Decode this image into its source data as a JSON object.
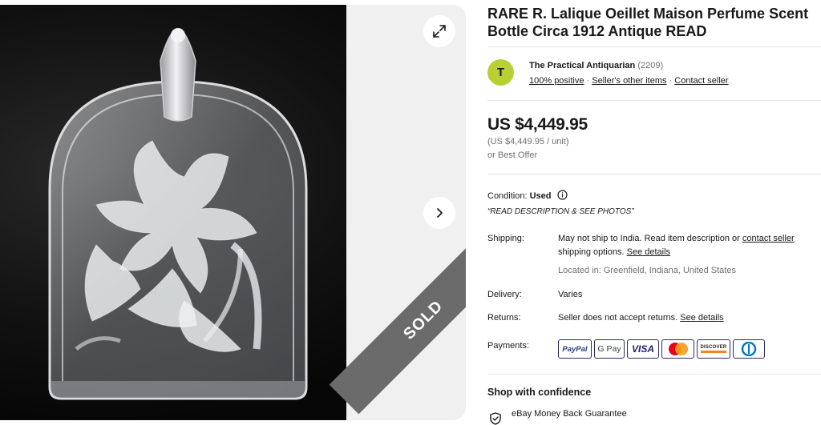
{
  "gallery": {
    "expand_icon": "expand-arrows-icon",
    "next_icon": "chevron-right-icon",
    "sold_label": "SOLD"
  },
  "listing": {
    "title": "RARE R. Lalique Oeillet Maison Perfume Scent\nBottle Circa 1912 Antique READ"
  },
  "seller": {
    "avatar_letter": "T",
    "name": "The Practical Antiquarian",
    "feedback_count": "(2209)",
    "positive": "100% positive",
    "sep": "·",
    "other_items": "Seller's other items",
    "contact": "Contact seller",
    "avatar_color": "#b9d033"
  },
  "price": {
    "amount": "US $4,449.95",
    "unit": "(US $4,449.95 / unit)",
    "offer": "or Best Offer"
  },
  "condition": {
    "label": "Condition:",
    "value": "Used",
    "note": "“READ DESCRIPTION & SEE PHOTOS”"
  },
  "shipping": {
    "label": "Shipping:",
    "text_1": "May not ship to India. Read item description or ",
    "contact_link": "contact seller",
    "text_2": "shipping options. ",
    "details_link": "See details",
    "location": "Located in: Greenfield, Indiana, United States"
  },
  "delivery": {
    "label": "Delivery:",
    "value": "Varies"
  },
  "returns": {
    "label": "Returns:",
    "value": "Seller does not accept returns. ",
    "details_link": "See details"
  },
  "payments": {
    "label": "Payments:",
    "methods": [
      "PayPal",
      "G Pay",
      "VISA",
      "Mastercard",
      "DISCOVER",
      "Diners Club"
    ]
  },
  "confidence": {
    "heading": "Shop with confidence",
    "guarantee": "eBay Money Back Guarantee"
  }
}
